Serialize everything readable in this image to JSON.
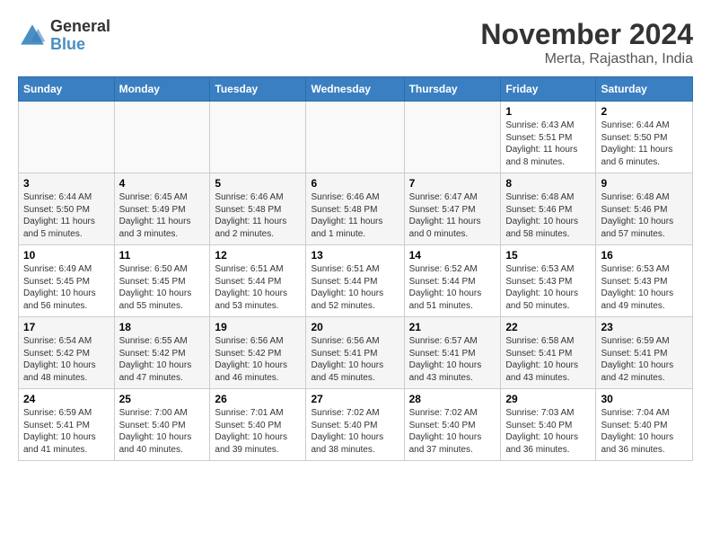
{
  "header": {
    "logo_line1": "General",
    "logo_line2": "Blue",
    "title": "November 2024",
    "subtitle": "Merta, Rajasthan, India"
  },
  "weekdays": [
    "Sunday",
    "Monday",
    "Tuesday",
    "Wednesday",
    "Thursday",
    "Friday",
    "Saturday"
  ],
  "weeks": [
    [
      {
        "day": "",
        "info": ""
      },
      {
        "day": "",
        "info": ""
      },
      {
        "day": "",
        "info": ""
      },
      {
        "day": "",
        "info": ""
      },
      {
        "day": "",
        "info": ""
      },
      {
        "day": "1",
        "info": "Sunrise: 6:43 AM\nSunset: 5:51 PM\nDaylight: 11 hours and 8 minutes."
      },
      {
        "day": "2",
        "info": "Sunrise: 6:44 AM\nSunset: 5:50 PM\nDaylight: 11 hours and 6 minutes."
      }
    ],
    [
      {
        "day": "3",
        "info": "Sunrise: 6:44 AM\nSunset: 5:50 PM\nDaylight: 11 hours and 5 minutes."
      },
      {
        "day": "4",
        "info": "Sunrise: 6:45 AM\nSunset: 5:49 PM\nDaylight: 11 hours and 3 minutes."
      },
      {
        "day": "5",
        "info": "Sunrise: 6:46 AM\nSunset: 5:48 PM\nDaylight: 11 hours and 2 minutes."
      },
      {
        "day": "6",
        "info": "Sunrise: 6:46 AM\nSunset: 5:48 PM\nDaylight: 11 hours and 1 minute."
      },
      {
        "day": "7",
        "info": "Sunrise: 6:47 AM\nSunset: 5:47 PM\nDaylight: 11 hours and 0 minutes."
      },
      {
        "day": "8",
        "info": "Sunrise: 6:48 AM\nSunset: 5:46 PM\nDaylight: 10 hours and 58 minutes."
      },
      {
        "day": "9",
        "info": "Sunrise: 6:48 AM\nSunset: 5:46 PM\nDaylight: 10 hours and 57 minutes."
      }
    ],
    [
      {
        "day": "10",
        "info": "Sunrise: 6:49 AM\nSunset: 5:45 PM\nDaylight: 10 hours and 56 minutes."
      },
      {
        "day": "11",
        "info": "Sunrise: 6:50 AM\nSunset: 5:45 PM\nDaylight: 10 hours and 55 minutes."
      },
      {
        "day": "12",
        "info": "Sunrise: 6:51 AM\nSunset: 5:44 PM\nDaylight: 10 hours and 53 minutes."
      },
      {
        "day": "13",
        "info": "Sunrise: 6:51 AM\nSunset: 5:44 PM\nDaylight: 10 hours and 52 minutes."
      },
      {
        "day": "14",
        "info": "Sunrise: 6:52 AM\nSunset: 5:44 PM\nDaylight: 10 hours and 51 minutes."
      },
      {
        "day": "15",
        "info": "Sunrise: 6:53 AM\nSunset: 5:43 PM\nDaylight: 10 hours and 50 minutes."
      },
      {
        "day": "16",
        "info": "Sunrise: 6:53 AM\nSunset: 5:43 PM\nDaylight: 10 hours and 49 minutes."
      }
    ],
    [
      {
        "day": "17",
        "info": "Sunrise: 6:54 AM\nSunset: 5:42 PM\nDaylight: 10 hours and 48 minutes."
      },
      {
        "day": "18",
        "info": "Sunrise: 6:55 AM\nSunset: 5:42 PM\nDaylight: 10 hours and 47 minutes."
      },
      {
        "day": "19",
        "info": "Sunrise: 6:56 AM\nSunset: 5:42 PM\nDaylight: 10 hours and 46 minutes."
      },
      {
        "day": "20",
        "info": "Sunrise: 6:56 AM\nSunset: 5:41 PM\nDaylight: 10 hours and 45 minutes."
      },
      {
        "day": "21",
        "info": "Sunrise: 6:57 AM\nSunset: 5:41 PM\nDaylight: 10 hours and 43 minutes."
      },
      {
        "day": "22",
        "info": "Sunrise: 6:58 AM\nSunset: 5:41 PM\nDaylight: 10 hours and 43 minutes."
      },
      {
        "day": "23",
        "info": "Sunrise: 6:59 AM\nSunset: 5:41 PM\nDaylight: 10 hours and 42 minutes."
      }
    ],
    [
      {
        "day": "24",
        "info": "Sunrise: 6:59 AM\nSunset: 5:41 PM\nDaylight: 10 hours and 41 minutes."
      },
      {
        "day": "25",
        "info": "Sunrise: 7:00 AM\nSunset: 5:40 PM\nDaylight: 10 hours and 40 minutes."
      },
      {
        "day": "26",
        "info": "Sunrise: 7:01 AM\nSunset: 5:40 PM\nDaylight: 10 hours and 39 minutes."
      },
      {
        "day": "27",
        "info": "Sunrise: 7:02 AM\nSunset: 5:40 PM\nDaylight: 10 hours and 38 minutes."
      },
      {
        "day": "28",
        "info": "Sunrise: 7:02 AM\nSunset: 5:40 PM\nDaylight: 10 hours and 37 minutes."
      },
      {
        "day": "29",
        "info": "Sunrise: 7:03 AM\nSunset: 5:40 PM\nDaylight: 10 hours and 36 minutes."
      },
      {
        "day": "30",
        "info": "Sunrise: 7:04 AM\nSunset: 5:40 PM\nDaylight: 10 hours and 36 minutes."
      }
    ]
  ]
}
